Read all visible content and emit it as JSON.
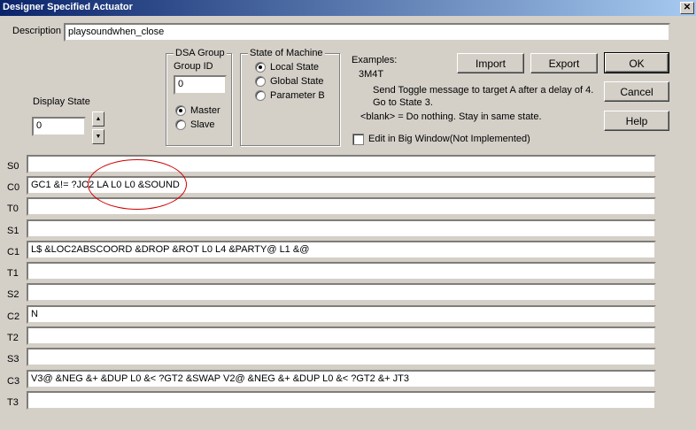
{
  "window": {
    "title": "Designer Specified Actuator",
    "close_glyph": "✕"
  },
  "description": {
    "label": "Description",
    "value": "playsoundwhen_close"
  },
  "display_state": {
    "label": "Display State",
    "value": "0"
  },
  "dsa_group": {
    "title": "DSA Group",
    "group_id_label": "Group ID",
    "group_id_value": "0",
    "master_label": "Master",
    "slave_label": "Slave"
  },
  "state_of_machine": {
    "title": "State of Machine",
    "local": "Local State",
    "global": "Global State",
    "param_b": "Parameter B"
  },
  "examples": {
    "heading": "Examples:",
    "code": "3M4T",
    "line1": "Send Toggle message to target A after a delay of 4.",
    "line2": "Go to State 3.",
    "blank": "<blank> = Do nothing.  Stay in same state."
  },
  "buttons": {
    "import": "Import",
    "export": "Export",
    "ok": "OK",
    "cancel": "Cancel",
    "help": "Help"
  },
  "big_window": {
    "label": "Edit in Big Window(Not Implemented)"
  },
  "rows": [
    {
      "label": "S0",
      "value": ""
    },
    {
      "label": "C0",
      "value": "GC1 &!= ?JC2 LA L0 L0 &SOUND"
    },
    {
      "label": "T0",
      "value": ""
    },
    {
      "label": "S1",
      "value": ""
    },
    {
      "label": "C1",
      "value": "L$ &LOC2ABSCOORD &DROP &ROT L0 L4 &PARTY@ L1 &@"
    },
    {
      "label": "T1",
      "value": ""
    },
    {
      "label": "S2",
      "value": ""
    },
    {
      "label": "C2",
      "value": "N"
    },
    {
      "label": "T2",
      "value": ""
    },
    {
      "label": "S3",
      "value": ""
    },
    {
      "label": "C3",
      "value": "V3@ &NEG &+ &DUP L0 &< ?GT2 &SWAP V2@ &NEG &+ &DUP L0 &< ?GT2 &+ JT3"
    },
    {
      "label": "T3",
      "value": ""
    }
  ]
}
